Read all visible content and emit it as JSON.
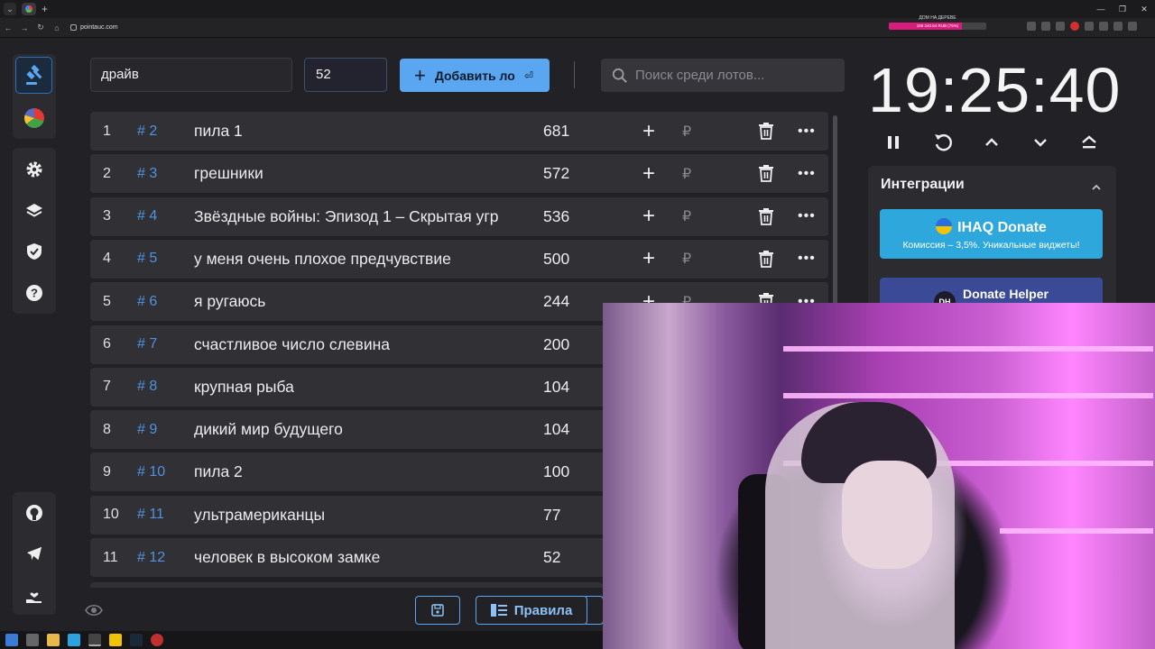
{
  "browser": {
    "url": "pointauc.com",
    "extension_banner_title": "ДОМ НА ДЕРЕВЕ",
    "extension_banner_progress": "158 240.54 RUB (75%)",
    "extension_banner_fill_percent": 75
  },
  "header": {
    "lot_name_value": "драйв",
    "amount_value": "52",
    "add_button_label": "Добавить ло",
    "search_placeholder": "Поиск среди лотов..."
  },
  "lots": [
    {
      "index": "1",
      "id": "# 2",
      "name": "пила 1",
      "amount": "681"
    },
    {
      "index": "2",
      "id": "# 3",
      "name": "грешники",
      "amount": "572"
    },
    {
      "index": "3",
      "id": "# 4",
      "name": "Звёздные войны: Эпизод 1 – Скрытая угр",
      "amount": "536"
    },
    {
      "index": "4",
      "id": "# 5",
      "name": "у меня очень плохое предчувствие",
      "amount": "500"
    },
    {
      "index": "5",
      "id": "# 6",
      "name": "я ругаюсь",
      "amount": "244"
    },
    {
      "index": "6",
      "id": "# 7",
      "name": "счастливое число слевина",
      "amount": "200"
    },
    {
      "index": "7",
      "id": "# 8",
      "name": "крупная рыба",
      "amount": "104"
    },
    {
      "index": "8",
      "id": "# 9",
      "name": "дикий мир будущего",
      "amount": "104"
    },
    {
      "index": "9",
      "id": "# 10",
      "name": "пила 2",
      "amount": "100"
    },
    {
      "index": "10",
      "id": "# 11",
      "name": "ультрамериканцы",
      "amount": "77"
    },
    {
      "index": "11",
      "id": "# 12",
      "name": "человек в высоком замке",
      "amount": "52"
    }
  ],
  "currency_symbol": "₽",
  "footer": {
    "rules_label": "Правила"
  },
  "timer": {
    "time": "19:25:40"
  },
  "integrations": {
    "title": "Интеграции",
    "ihaq_name": "IHAQ Donate",
    "ihaq_subtitle": "Комиссия – 3,5%. Уникальные виджеты!",
    "donate_helper_name": "Donate Helper",
    "donate_helper_logo": "DH"
  },
  "colors": {
    "accent": "#5aa6f0",
    "lot_id": "#4f93e0",
    "row_bg": "#303035",
    "ihaq_bg": "#2ea8dc",
    "donate_helper_bg": "#3a4a96",
    "banner_fill": "#d81c7c"
  }
}
